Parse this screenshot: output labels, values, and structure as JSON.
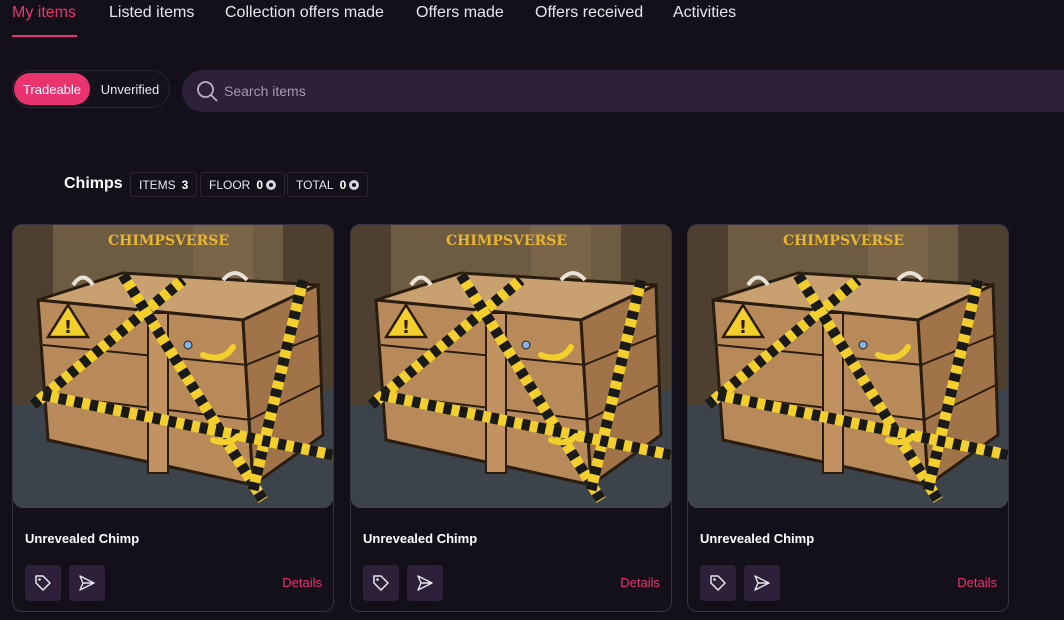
{
  "tabs": [
    {
      "label": "My items",
      "active": true
    },
    {
      "label": "Listed items",
      "active": false
    },
    {
      "label": "Collection offers made",
      "active": false
    },
    {
      "label": "Offers made",
      "active": false
    },
    {
      "label": "Offers received",
      "active": false
    },
    {
      "label": "Activities",
      "active": false
    }
  ],
  "filter_toggle": {
    "on_label": "Tradeable",
    "off_label": "Unverified",
    "selected": "Tradeable"
  },
  "search": {
    "placeholder": "Search items",
    "value": ""
  },
  "collection": {
    "name": "Chimps",
    "stats": [
      {
        "label": "ITEMS",
        "value": "3"
      },
      {
        "label": "FLOOR",
        "value": "0",
        "icon": "coin-icon"
      },
      {
        "label": "TOTAL",
        "value": "0",
        "icon": "coin-icon"
      }
    ]
  },
  "cards": [
    {
      "title": "Unrevealed Chimp",
      "image_logo": "CHIMPSVERSE",
      "details_label": "Details"
    },
    {
      "title": "Unrevealed Chimp",
      "image_logo": "CHIMPSVERSE",
      "details_label": "Details"
    },
    {
      "title": "Unrevealed Chimp",
      "image_logo": "CHIMPSVERSE",
      "details_label": "Details"
    }
  ],
  "colors": {
    "accent": "#e8336f",
    "background": "#14101a",
    "surface": "#2c2138"
  }
}
